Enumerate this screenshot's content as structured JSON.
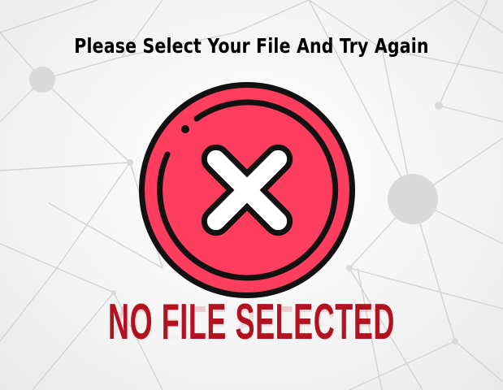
{
  "message": {
    "headline": "Please Select Your File And Try Again",
    "status": "NO FILE SELECTED"
  },
  "icon": {
    "name": "close-circle-icon",
    "fill_color": "#ff3d5e",
    "outline_color": "#111111",
    "cross_color": "#ffffff"
  },
  "colors": {
    "status_text": "#b31220",
    "network_lines": "#cfcfcf",
    "network_nodes": "#d9d9d9"
  }
}
